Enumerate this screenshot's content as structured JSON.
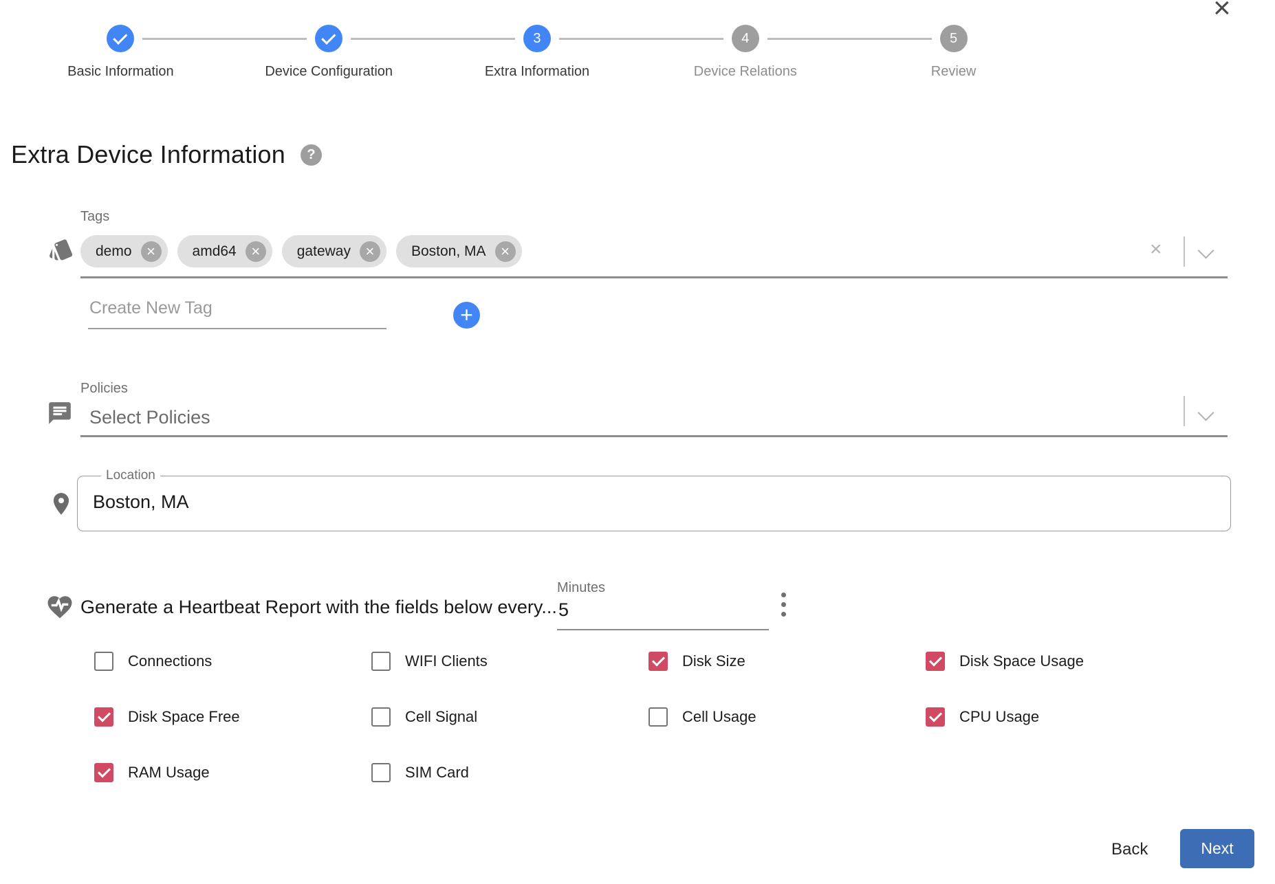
{
  "window": {
    "close_icon": "×"
  },
  "stepper": {
    "steps": [
      {
        "label": "Basic Information",
        "state": "completed",
        "number": "1"
      },
      {
        "label": "Device Configuration",
        "state": "completed",
        "number": "2"
      },
      {
        "label": "Extra Information",
        "state": "active",
        "number": "3"
      },
      {
        "label": "Device Relations",
        "state": "upcoming",
        "number": "4"
      },
      {
        "label": "Review",
        "state": "upcoming",
        "number": "5"
      }
    ]
  },
  "header": {
    "title": "Extra Device Information",
    "help_icon": "?"
  },
  "tags": {
    "label": "Tags",
    "chips": [
      "demo",
      "amd64",
      "gateway",
      "Boston, MA"
    ],
    "chip_remove_icon": "×",
    "clear_icon": "×",
    "create_placeholder": "Create New Tag",
    "add_icon": "+"
  },
  "policies": {
    "label": "Policies",
    "placeholder": "Select Policies"
  },
  "location": {
    "label": "Location",
    "value": "Boston, MA"
  },
  "heartbeat": {
    "text": "Generate a Heartbeat Report with the fields below every...",
    "minutes_label": "Minutes",
    "minutes_value": "5",
    "fields": [
      {
        "label": "Connections",
        "checked": false
      },
      {
        "label": "WIFI Clients",
        "checked": false
      },
      {
        "label": "Disk Size",
        "checked": true
      },
      {
        "label": "Disk Space Usage",
        "checked": true
      },
      {
        "label": "Disk Space Free",
        "checked": true
      },
      {
        "label": "Cell Signal",
        "checked": false
      },
      {
        "label": "Cell Usage",
        "checked": false
      },
      {
        "label": "CPU Usage",
        "checked": true
      },
      {
        "label": "RAM Usage",
        "checked": true
      },
      {
        "label": "SIM Card",
        "checked": false
      }
    ]
  },
  "footer": {
    "back_label": "Back",
    "next_label": "Next"
  },
  "colors": {
    "primary_blue": "#4285f4",
    "next_button_blue": "#3d6db4",
    "checkbox_checked_red": "#d14a63",
    "inactive_gray": "#9e9e9e",
    "chip_bg": "#e0e0e0"
  }
}
